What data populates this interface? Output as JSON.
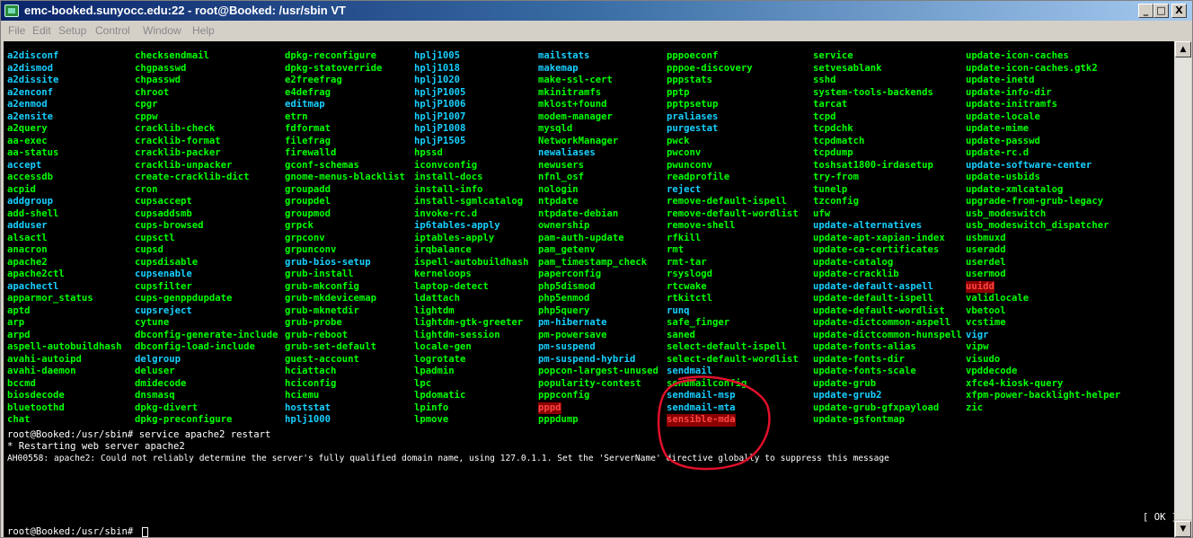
{
  "window": {
    "title": "emc-booked.sunyocc.edu:22 - root@Booked: /usr/sbin VT",
    "min": "_",
    "max": "□",
    "close": "X"
  },
  "menu": [
    "File",
    "Edit",
    "Setup",
    "Control",
    "Window",
    "Help"
  ],
  "columns": [
    [
      {
        "t": "a2disconf",
        "c": 1
      },
      {
        "t": "a2dismod",
        "c": 1
      },
      {
        "t": "a2dissite",
        "c": 1
      },
      {
        "t": "a2enconf",
        "c": 1
      },
      {
        "t": "a2enmod",
        "c": 1
      },
      {
        "t": "a2ensite",
        "c": 1
      },
      {
        "t": "a2query"
      },
      {
        "t": "aa-exec"
      },
      {
        "t": "aa-status"
      },
      {
        "t": "accept",
        "c": 1
      },
      {
        "t": "accessdb"
      },
      {
        "t": "acpid"
      },
      {
        "t": "addgroup",
        "c": 1
      },
      {
        "t": "add-shell"
      },
      {
        "t": "adduser",
        "c": 1
      },
      {
        "t": "alsactl"
      },
      {
        "t": "anacron"
      },
      {
        "t": "apache2"
      },
      {
        "t": "apache2ctl"
      },
      {
        "t": "apachectl",
        "c": 1
      },
      {
        "t": "apparmor_status"
      },
      {
        "t": "aptd"
      },
      {
        "t": "arp"
      },
      {
        "t": "arpd"
      },
      {
        "t": "aspell-autobuildhash"
      },
      {
        "t": "avahi-autoipd"
      },
      {
        "t": "avahi-daemon"
      },
      {
        "t": "bccmd"
      },
      {
        "t": "biosdecode"
      },
      {
        "t": "bluetoothd"
      },
      {
        "t": "chat"
      }
    ],
    [
      {
        "t": "checksendmail"
      },
      {
        "t": "chgpasswd"
      },
      {
        "t": "chpasswd"
      },
      {
        "t": "chroot"
      },
      {
        "t": "cpgr"
      },
      {
        "t": "cppw"
      },
      {
        "t": "cracklib-check"
      },
      {
        "t": "cracklib-format"
      },
      {
        "t": "cracklib-packer"
      },
      {
        "t": "cracklib-unpacker"
      },
      {
        "t": "create-cracklib-dict"
      },
      {
        "t": "cron"
      },
      {
        "t": "cupsaccept"
      },
      {
        "t": "cupsaddsmb"
      },
      {
        "t": "cups-browsed"
      },
      {
        "t": "cupsctl"
      },
      {
        "t": "cupsd"
      },
      {
        "t": "cupsdisable"
      },
      {
        "t": "cupsenable",
        "c": 1
      },
      {
        "t": "cupsfilter"
      },
      {
        "t": "cups-genppdupdate"
      },
      {
        "t": "cupsreject",
        "c": 1
      },
      {
        "t": "cytune"
      },
      {
        "t": "dbconfig-generate-include"
      },
      {
        "t": "dbconfig-load-include"
      },
      {
        "t": "delgroup",
        "c": 1
      },
      {
        "t": "deluser"
      },
      {
        "t": "dmidecode"
      },
      {
        "t": "dnsmasq"
      },
      {
        "t": "dpkg-divert"
      },
      {
        "t": "dpkg-preconfigure"
      }
    ],
    [
      {
        "t": "dpkg-reconfigure"
      },
      {
        "t": "dpkg-statoverride"
      },
      {
        "t": "e2freefrag"
      },
      {
        "t": "e4defrag"
      },
      {
        "t": "editmap",
        "c": 1
      },
      {
        "t": "etrn"
      },
      {
        "t": "fdformat"
      },
      {
        "t": "filefrag"
      },
      {
        "t": "firewalld"
      },
      {
        "t": "gconf-schemas"
      },
      {
        "t": "gnome-menus-blacklist"
      },
      {
        "t": "groupadd"
      },
      {
        "t": "groupdel"
      },
      {
        "t": "groupmod"
      },
      {
        "t": "grpck"
      },
      {
        "t": "grpconv"
      },
      {
        "t": "grpunconv"
      },
      {
        "t": "grub-bios-setup",
        "c": 1
      },
      {
        "t": "grub-install"
      },
      {
        "t": "grub-mkconfig"
      },
      {
        "t": "grub-mkdevicemap"
      },
      {
        "t": "grub-mknetdir"
      },
      {
        "t": "grub-probe"
      },
      {
        "t": "grub-reboot"
      },
      {
        "t": "grub-set-default"
      },
      {
        "t": "guest-account"
      },
      {
        "t": "hciattach"
      },
      {
        "t": "hciconfig"
      },
      {
        "t": "hciemu"
      },
      {
        "t": "hoststat",
        "c": 1
      },
      {
        "t": "hplj1000",
        "c": 1
      }
    ],
    [
      {
        "t": "hplj1005",
        "c": 1
      },
      {
        "t": "hplj1018",
        "c": 1
      },
      {
        "t": "hplj1020",
        "c": 1
      },
      {
        "t": "hpljP1005",
        "c": 1
      },
      {
        "t": "hpljP1006",
        "c": 1
      },
      {
        "t": "hpljP1007",
        "c": 1
      },
      {
        "t": "hpljP1008",
        "c": 1
      },
      {
        "t": "hpljP1505",
        "c": 1
      },
      {
        "t": "hpssd"
      },
      {
        "t": "iconvconfig"
      },
      {
        "t": "install-docs"
      },
      {
        "t": "install-info"
      },
      {
        "t": "install-sgmlcatalog"
      },
      {
        "t": "invoke-rc.d"
      },
      {
        "t": "ip6tables-apply",
        "c": 1
      },
      {
        "t": "iptables-apply"
      },
      {
        "t": "irqbalance"
      },
      {
        "t": "ispell-autobuildhash"
      },
      {
        "t": "kerneloops"
      },
      {
        "t": "laptop-detect"
      },
      {
        "t": "ldattach"
      },
      {
        "t": "lightdm"
      },
      {
        "t": "lightdm-gtk-greeter"
      },
      {
        "t": "lightdm-session"
      },
      {
        "t": "locale-gen"
      },
      {
        "t": "logrotate"
      },
      {
        "t": "lpadmin"
      },
      {
        "t": "lpc"
      },
      {
        "t": "lpdomatic"
      },
      {
        "t": "lpinfo"
      },
      {
        "t": "lpmove"
      }
    ],
    [
      {
        "t": "mailstats",
        "c": 1
      },
      {
        "t": "makemap",
        "c": 1
      },
      {
        "t": "make-ssl-cert"
      },
      {
        "t": "mkinitramfs"
      },
      {
        "t": "mklost+found"
      },
      {
        "t": "modem-manager"
      },
      {
        "t": "mysqld"
      },
      {
        "t": "NetworkManager"
      },
      {
        "t": "newaliases",
        "c": 1
      },
      {
        "t": "newusers"
      },
      {
        "t": "nfnl_osf"
      },
      {
        "t": "nologin"
      },
      {
        "t": "ntpdate"
      },
      {
        "t": "ntpdate-debian"
      },
      {
        "t": "ownership"
      },
      {
        "t": "pam-auth-update"
      },
      {
        "t": "pam_getenv"
      },
      {
        "t": "pam_timestamp_check"
      },
      {
        "t": "paperconfig"
      },
      {
        "t": "php5dismod"
      },
      {
        "t": "php5enmod"
      },
      {
        "t": "php5query"
      },
      {
        "t": "pm-hibernate",
        "c": 1
      },
      {
        "t": "pm-powersave"
      },
      {
        "t": "pm-suspend",
        "c": 1
      },
      {
        "t": "pm-suspend-hybrid",
        "c": 1
      },
      {
        "t": "popcon-largest-unused"
      },
      {
        "t": "popularity-contest"
      },
      {
        "t": "pppconfig"
      },
      {
        "t": "pppd",
        "r": 1
      },
      {
        "t": "pppdump"
      }
    ],
    [
      {
        "t": "pppoeconf"
      },
      {
        "t": "pppoe-discovery"
      },
      {
        "t": "pppstats"
      },
      {
        "t": "pptp"
      },
      {
        "t": "pptpsetup"
      },
      {
        "t": "praliases",
        "c": 1
      },
      {
        "t": "purgestat",
        "c": 1
      },
      {
        "t": "pwck"
      },
      {
        "t": "pwconv"
      },
      {
        "t": "pwunconv"
      },
      {
        "t": "readprofile"
      },
      {
        "t": "reject",
        "c": 1
      },
      {
        "t": "remove-default-ispell"
      },
      {
        "t": "remove-default-wordlist"
      },
      {
        "t": "remove-shell"
      },
      {
        "t": "rfkill"
      },
      {
        "t": "rmt"
      },
      {
        "t": "rmt-tar"
      },
      {
        "t": "rsyslogd"
      },
      {
        "t": "rtcwake"
      },
      {
        "t": "rtkitctl"
      },
      {
        "t": "runq",
        "c": 1
      },
      {
        "t": "safe_finger"
      },
      {
        "t": "saned"
      },
      {
        "t": "select-default-ispell"
      },
      {
        "t": "select-default-wordlist"
      },
      {
        "t": "sendmail",
        "c": 1
      },
      {
        "t": "sendmailconfig"
      },
      {
        "t": "sendmail-msp",
        "c": 1
      },
      {
        "t": "sendmail-mta",
        "c": 1
      },
      {
        "t": "sensible-mda",
        "r": 1
      }
    ],
    [
      {
        "t": "service"
      },
      {
        "t": "setvesablank"
      },
      {
        "t": "sshd"
      },
      {
        "t": "system-tools-backends"
      },
      {
        "t": "tarcat"
      },
      {
        "t": "tcpd"
      },
      {
        "t": "tcpdchk"
      },
      {
        "t": "tcpdmatch"
      },
      {
        "t": "tcpdump"
      },
      {
        "t": "toshsat1800-irdasetup"
      },
      {
        "t": "try-from"
      },
      {
        "t": "tunelp"
      },
      {
        "t": "tzconfig"
      },
      {
        "t": "ufw"
      },
      {
        "t": "update-alternatives",
        "c": 1
      },
      {
        "t": "update-apt-xapian-index"
      },
      {
        "t": "update-ca-certificates"
      },
      {
        "t": "update-catalog"
      },
      {
        "t": "update-cracklib"
      },
      {
        "t": "update-default-aspell",
        "c": 1
      },
      {
        "t": "update-default-ispell"
      },
      {
        "t": "update-default-wordlist"
      },
      {
        "t": "update-dictcommon-aspell"
      },
      {
        "t": "update-dictcommon-hunspell"
      },
      {
        "t": "update-fonts-alias"
      },
      {
        "t": "update-fonts-dir"
      },
      {
        "t": "update-fonts-scale"
      },
      {
        "t": "update-grub"
      },
      {
        "t": "update-grub2",
        "c": 1
      },
      {
        "t": "update-grub-gfxpayload"
      },
      {
        "t": "update-gsfontmap"
      }
    ],
    [
      {
        "t": "update-icon-caches"
      },
      {
        "t": "update-icon-caches.gtk2"
      },
      {
        "t": "update-inetd"
      },
      {
        "t": "update-info-dir"
      },
      {
        "t": "update-initramfs"
      },
      {
        "t": "update-locale"
      },
      {
        "t": "update-mime"
      },
      {
        "t": "update-passwd"
      },
      {
        "t": "update-rc.d"
      },
      {
        "t": "update-software-center",
        "c": 1
      },
      {
        "t": "update-usbids"
      },
      {
        "t": "update-xmlcatalog"
      },
      {
        "t": "upgrade-from-grub-legacy"
      },
      {
        "t": "usb_modeswitch"
      },
      {
        "t": "usb_modeswitch_dispatcher"
      },
      {
        "t": "usbmuxd"
      },
      {
        "t": "useradd"
      },
      {
        "t": "userdel"
      },
      {
        "t": "usermod"
      },
      {
        "t": "uuidd",
        "r": 1
      },
      {
        "t": "validlocale"
      },
      {
        "t": "vbetool"
      },
      {
        "t": "vcstime"
      },
      {
        "t": "vigr",
        "c": 1
      },
      {
        "t": "vipw"
      },
      {
        "t": "visudo"
      },
      {
        "t": "vpddecode"
      },
      {
        "t": "xfce4-kiosk-query"
      },
      {
        "t": "xfpm-power-backlight-helper"
      },
      {
        "t": "zic"
      }
    ]
  ],
  "output": {
    "line1": "root@Booked:/usr/sbin# service apache2 restart",
    "line2": " * Restarting web server apache2",
    "line3": "AH00558: apache2: Could not reliably determine the server's fully qualified domain name, using 127.0.1.1. Set the 'ServerName' directive globally to suppress this message",
    "ok": "[ OK ]",
    "prompt": "root@Booked:/usr/sbin# "
  },
  "scroll": {
    "up": "▲",
    "down": "▼"
  },
  "colors": {
    "accent": "#00ff00",
    "highlight": "#16d0ff",
    "annotation": "#e0102a"
  }
}
